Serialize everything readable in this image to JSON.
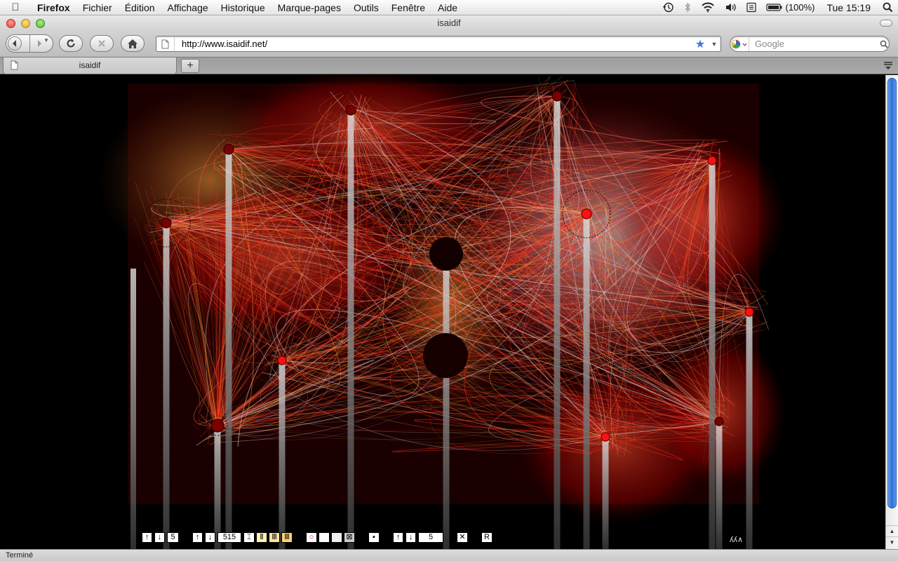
{
  "menubar": {
    "app_name": "Firefox",
    "items": [
      "Fichier",
      "Édition",
      "Affichage",
      "Historique",
      "Marque-pages",
      "Outils",
      "Fenêtre",
      "Aide"
    ],
    "battery_text": "(100%)",
    "clock": "Tue 15:19",
    "status_icons": [
      "time-machine-icon",
      "bluetooth-icon",
      "wifi-icon",
      "volume-icon",
      "keyboard-input-icon",
      "battery-icon",
      "spotlight-icon"
    ]
  },
  "window": {
    "title": "isaidif"
  },
  "toolbar": {
    "url": "http://www.isaidif.net/",
    "search_placeholder": "Google"
  },
  "tabs": [
    {
      "label": "isaidif"
    }
  ],
  "new_tab_label": "+",
  "artwork": {
    "background": "#000000",
    "palette": {
      "deep_red": "#7a0000",
      "red": "#ff2a1a",
      "orange": "#f0902a",
      "white": "#f4e8e8",
      "bar": "#cfcfcf"
    },
    "nodes": [
      {
        "style": "dark"
      },
      {
        "style": "dark"
      },
      {
        "style": "dark"
      },
      {
        "style": "bright"
      },
      {
        "style": "dark"
      },
      {
        "style": "dark"
      },
      {
        "style": "bright"
      },
      {
        "style": "bright"
      },
      {
        "style": "bright"
      },
      {
        "style": "bright"
      },
      {
        "style": "dark"
      },
      {
        "style": "dark"
      },
      {
        "style": "dark"
      }
    ]
  },
  "controls": {
    "group1": {
      "up": "↑",
      "down": "↓",
      "value": "5"
    },
    "group2": {
      "up": "↑",
      "down": "↓",
      "value": "515",
      "options": [
        "⌶",
        "Ⅱ",
        "Ⅲ",
        "Ⅲ"
      ]
    },
    "group3": {
      "options": [
        "○",
        "",
        "",
        "⊠"
      ]
    },
    "single": "▪",
    "group4": {
      "up": "↑",
      "down": "↓",
      "value": "5"
    },
    "clear": "✕",
    "reset": "R",
    "logo": "ʎʎ∧"
  },
  "statusbar": {
    "text": "Terminé"
  }
}
